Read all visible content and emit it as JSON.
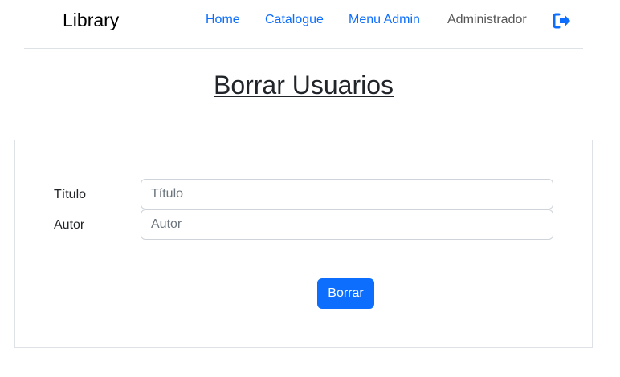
{
  "navbar": {
    "brand": "Library",
    "links": [
      {
        "label": "Home"
      },
      {
        "label": "Catalogue"
      },
      {
        "label": "Menu Admin"
      }
    ],
    "user": "Administrador",
    "logout_icon": "sign-out-icon",
    "accent_color": "#0d6efd"
  },
  "page": {
    "title": "Borrar Usuarios"
  },
  "form": {
    "fields": [
      {
        "label": "Título",
        "placeholder": "Título",
        "value": ""
      },
      {
        "label": "Autor",
        "placeholder": "Autor",
        "value": ""
      }
    ],
    "submit_label": "Borrar"
  }
}
